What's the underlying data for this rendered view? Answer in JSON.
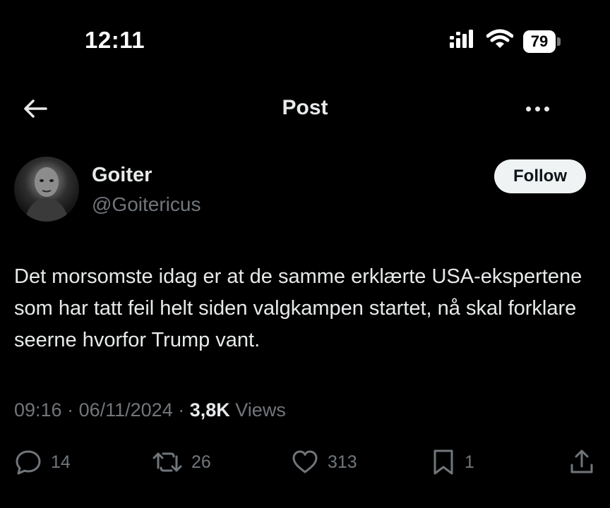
{
  "status_bar": {
    "time": "12:11",
    "battery": "79",
    "icons": [
      "signal-icon",
      "wifi-icon",
      "battery-icon"
    ]
  },
  "header": {
    "title": "Post",
    "back_icon": "back-arrow-icon",
    "more_icon": "more-icon"
  },
  "author": {
    "name": "Goiter",
    "handle": "@Goitericus",
    "follow_label": "Follow"
  },
  "post": {
    "text": "Det morsomste idag er at de samme erklærte USA-ekspertene som har tatt feil helt siden valgkampen startet, nå skal forklare seerne hvorfor Trump vant."
  },
  "meta": {
    "time": "09:16",
    "date": "06/11/2024",
    "views_count": "3,8K",
    "views_label": "Views"
  },
  "actions": {
    "replies": "14",
    "reposts": "26",
    "likes": "313",
    "bookmarks": "1"
  },
  "colors": {
    "background": "#000000",
    "text": "#e7e9ea",
    "secondary": "#71767b",
    "follow_bg": "#eff3f4"
  }
}
